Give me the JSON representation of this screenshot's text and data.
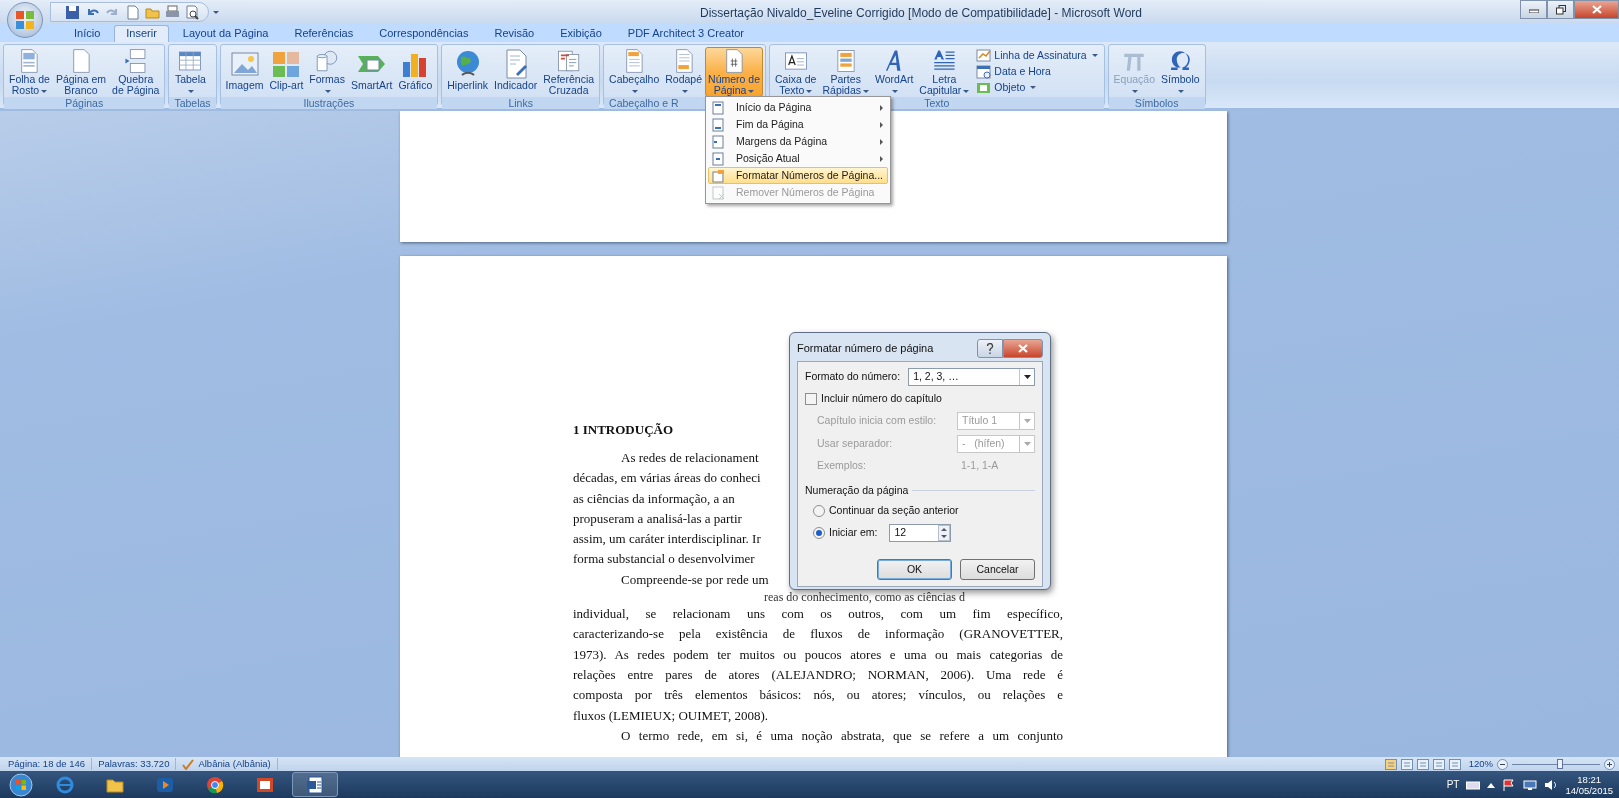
{
  "window": {
    "title": "Dissertação Nivaldo_Eveline Corrigido [Modo de Compatibilidade] - Microsoft Word"
  },
  "tabs": [
    {
      "label": "Início",
      "selected": false
    },
    {
      "label": "Inserir",
      "selected": true
    },
    {
      "label": "Layout da Página",
      "selected": false
    },
    {
      "label": "Referências",
      "selected": false
    },
    {
      "label": "Correspondências",
      "selected": false
    },
    {
      "label": "Revisão",
      "selected": false
    },
    {
      "label": "Exibição",
      "selected": false
    },
    {
      "label": "PDF Architect 3 Creator",
      "selected": false
    }
  ],
  "ribbon_groups": [
    {
      "label": "Páginas",
      "items": [
        {
          "lines": [
            "Folha de",
            "Rosto"
          ],
          "dropdown": true,
          "pressed": false,
          "disabled": false
        },
        {
          "lines": [
            "Página em",
            "Branco"
          ],
          "dropdown": false,
          "pressed": false,
          "disabled": false
        },
        {
          "lines": [
            "Quebra",
            "de Página"
          ],
          "dropdown": false,
          "pressed": false,
          "disabled": false
        }
      ]
    },
    {
      "label": "Tabelas",
      "items": [
        {
          "lines": [
            "Tabela"
          ],
          "dropdown": true,
          "pressed": false,
          "disabled": false
        }
      ]
    },
    {
      "label": "Ilustrações",
      "items": [
        {
          "lines": [
            "Imagem"
          ],
          "dropdown": false,
          "pressed": false,
          "disabled": false
        },
        {
          "lines": [
            "Clip-art"
          ],
          "dropdown": false,
          "pressed": false,
          "disabled": false
        },
        {
          "lines": [
            "Formas"
          ],
          "dropdown": true,
          "pressed": false,
          "disabled": false
        },
        {
          "lines": [
            "SmartArt"
          ],
          "dropdown": false,
          "pressed": false,
          "disabled": false
        },
        {
          "lines": [
            "Gráfico"
          ],
          "dropdown": false,
          "pressed": false,
          "disabled": false
        }
      ]
    },
    {
      "label": "Links",
      "items": [
        {
          "lines": [
            "Hiperlink"
          ],
          "dropdown": false,
          "pressed": false,
          "disabled": false
        },
        {
          "lines": [
            "Indicador"
          ],
          "dropdown": false,
          "pressed": false,
          "disabled": false
        },
        {
          "lines": [
            "Referência",
            "Cruzada"
          ],
          "dropdown": false,
          "pressed": false,
          "disabled": false
        }
      ]
    },
    {
      "label": "Cabeçalho e R",
      "items": [
        {
          "lines": [
            "Cabeçalho"
          ],
          "dropdown": true,
          "pressed": false,
          "disabled": false
        },
        {
          "lines": [
            "Rodapé"
          ],
          "dropdown": true,
          "pressed": false,
          "disabled": false
        },
        {
          "lines": [
            "Número de",
            "Página"
          ],
          "dropdown": true,
          "pressed": true,
          "disabled": false
        }
      ]
    },
    {
      "label": "Texto",
      "items": [
        {
          "lines": [
            "Caixa de",
            "Texto"
          ],
          "dropdown": true,
          "pressed": false,
          "disabled": false
        },
        {
          "lines": [
            "Partes",
            "Rápidas"
          ],
          "dropdown": true,
          "pressed": false,
          "disabled": false
        },
        {
          "lines": [
            "WordArt"
          ],
          "dropdown": true,
          "pressed": false,
          "disabled": false
        },
        {
          "lines": [
            "Letra",
            "Capitular"
          ],
          "dropdown": true,
          "pressed": false,
          "disabled": false
        }
      ],
      "small_items": [
        {
          "label": "Linha de Assinatura",
          "dropdown": true
        },
        {
          "label": "Data e Hora",
          "dropdown": false
        },
        {
          "label": "Objeto",
          "dropdown": true
        }
      ]
    },
    {
      "label": "Símbolos",
      "items": [
        {
          "lines": [
            "Equação"
          ],
          "dropdown": true,
          "pressed": false,
          "disabled": true
        },
        {
          "lines": [
            "Símbolo"
          ],
          "dropdown": true,
          "pressed": false,
          "disabled": false
        }
      ]
    }
  ],
  "page_number_menu": [
    {
      "label": "Início da Página",
      "submenu": true,
      "highlighted": false,
      "disabled": false
    },
    {
      "label": "Fim da Página",
      "submenu": true,
      "highlighted": false,
      "disabled": false
    },
    {
      "label": "Margens da Página",
      "submenu": true,
      "highlighted": false,
      "disabled": false
    },
    {
      "label": "Posição Atual",
      "submenu": true,
      "highlighted": false,
      "disabled": false
    },
    {
      "label": "Formatar Números de Página...",
      "submenu": false,
      "highlighted": true,
      "disabled": false
    },
    {
      "label": "Remover Números de Página",
      "submenu": false,
      "highlighted": false,
      "disabled": true
    }
  ],
  "document": {
    "heading": "1 INTRODUÇÃO",
    "lines": [
      {
        "text": "As redes de relacionament",
        "kind": "partial",
        "indent": true
      },
      {
        "text": "décadas, em várias áreas do conheci",
        "kind": "partial",
        "indent": false
      },
      {
        "text": "as ciências da informação, a an",
        "kind": "partial",
        "indent": false
      },
      {
        "text": "propuseram a analisá-las a partir",
        "kind": "partial",
        "indent": false
      },
      {
        "text": "assim, um caráter interdisciplinar. Ir",
        "kind": "partial",
        "indent": false
      },
      {
        "text": "forma substancial o desenvolvimer",
        "kind": "partial",
        "indent": false
      },
      {
        "text": "Compreende-se por rede um",
        "kind": "partial",
        "indent": true
      },
      {
        "text": "reas do conhecimento, como as ciências d",
        "kind": "overlap",
        "indent": false
      },
      {
        "text": "individual, se relacionam uns com os outros, com um fim específico,",
        "kind": "full",
        "indent": false
      },
      {
        "text": "caracterizando-se pela existência de fluxos de informação (GRANOVETTER,",
        "kind": "full",
        "indent": false
      },
      {
        "text": "1973). As redes podem ter muitos ou poucos atores e uma ou mais categorias de",
        "kind": "full",
        "indent": false
      },
      {
        "text": "relações entre pares de atores (ALEJANDRO; NORMAN, 2006). Uma rede é",
        "kind": "full",
        "indent": false
      },
      {
        "text": "composta por três elementos básicos: nós, ou atores; vínculos, ou relações e",
        "kind": "full",
        "indent": false
      },
      {
        "text": "fluxos (LEMIEUX; OUIMET, 2008).",
        "kind": "end",
        "indent": false
      },
      {
        "text": "O termo rede, em si, é uma noção abstrata, que se refere a um conjunto",
        "kind": "full",
        "indent": true
      }
    ]
  },
  "dialog": {
    "title": "Formatar número de página",
    "format_label": "Formato do número:",
    "format_value": "1, 2, 3, …",
    "include_chapter": {
      "label": "Incluir número do capítulo",
      "checked": false
    },
    "chapter_fields": [
      {
        "label": "Capítulo inicia com estilo:",
        "value": "Título 1",
        "kind": "select",
        "disabled": true
      },
      {
        "label": "Usar separador:",
        "value": "-   (hífen)",
        "kind": "select",
        "disabled": true
      },
      {
        "label": "Exemplos:",
        "value": "1-1, 1-A",
        "kind": "text",
        "disabled": true
      }
    ],
    "numbering_label": "Numeração da página",
    "numbering_options": [
      {
        "label": "Continuar da seção anterior",
        "selected": false
      },
      {
        "label": "Iniciar em:",
        "selected": true
      }
    ],
    "start_value": "12",
    "buttons": [
      {
        "label": "OK",
        "default": true
      },
      {
        "label": "Cancelar",
        "default": false
      }
    ]
  },
  "status_bar": {
    "page": "Página: 18 de 146",
    "words": "Palavras: 33.720",
    "language": "Albânia (Albânia)",
    "zoom": "120%",
    "zoom_slider": {
      "level": 0.55
    }
  },
  "taskbar": {
    "language": "PT",
    "time": "18:21",
    "date": "14/05/2015"
  }
}
